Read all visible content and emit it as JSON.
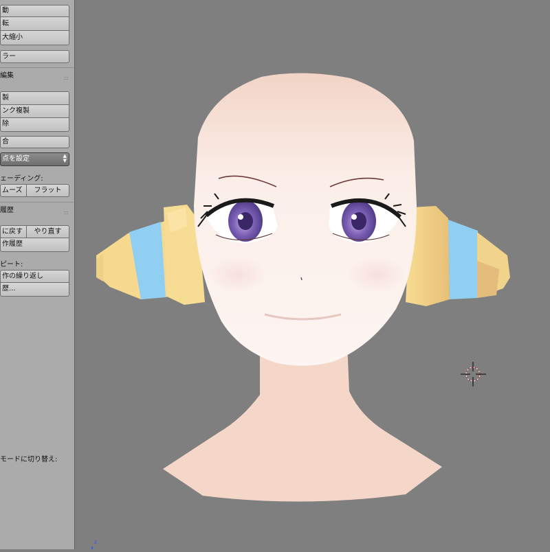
{
  "toolshelf": {
    "transform": {
      "move": "動",
      "rotate": "転",
      "scale": "大縮小",
      "mirror": "ラー"
    },
    "mesh_edit": {
      "title": "編集",
      "duplicate": "製",
      "link_duplicate": "ンク複製",
      "delete": "除",
      "join": "合",
      "set_origin": "点を設定",
      "shading_label": "ェーディング:",
      "smooth": "ムーズ",
      "flat": "フラット"
    },
    "history": {
      "title": "履歴",
      "undo": "に戻す",
      "redo": "やり直す",
      "undo_history": "作履歴",
      "repeat_label": "ピート:",
      "repeat_last": "作の繰り返し",
      "repeat_history": "歴..."
    },
    "mode_switch_text": "モードに切り替え:"
  },
  "viewport": {
    "axis_label": "z",
    "background_color": "#7f7f7f",
    "cursor_color": "#cc2222"
  }
}
